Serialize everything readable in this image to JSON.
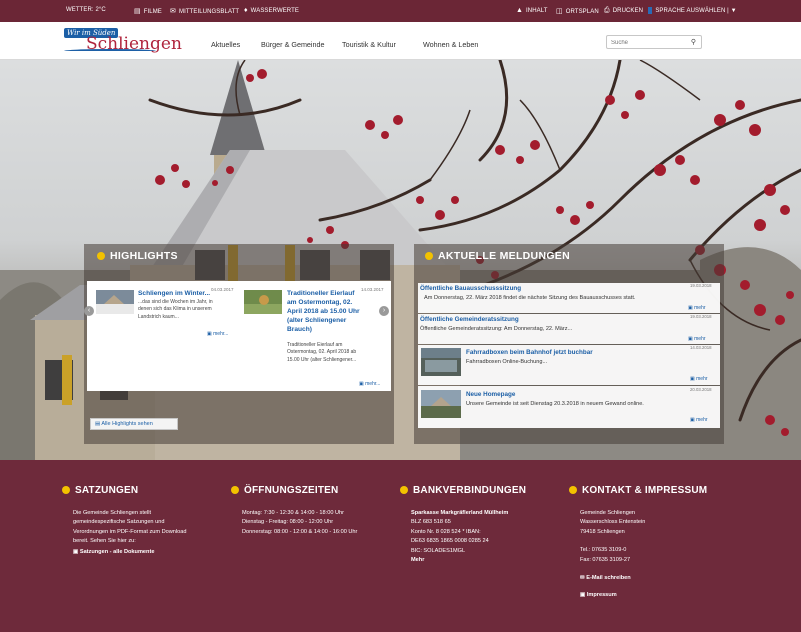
{
  "topbar": {
    "weather": "WETTER: 2°C",
    "film": "FILME",
    "newsletter": "MITTEILUNGSBLATT",
    "water": "WASSERWERTE",
    "contents": "INHALT",
    "city_map": "ORTSPLAN",
    "print": "DRUCKEN",
    "language": "SPRACHE AUSWÄHLEN | ▼"
  },
  "logo": {
    "tagline": "Wir im Süden",
    "name": "Schliengen"
  },
  "nav": {
    "items": [
      "Aktuelles",
      "Bürger & Gemeinde",
      "Touristik & Kultur",
      "Wohnen & Leben"
    ]
  },
  "search": {
    "placeholder": "Suche"
  },
  "highlights": {
    "title": "HIGHLIGHTS",
    "all_label": "Alle Highlights sehen",
    "cards": [
      {
        "title": "Schliengen im Winter...",
        "date": "04.03.2017",
        "lines": [
          "...das sind die Wochen im Jahr, in",
          "denen sich das Klima in unserem",
          "Landstrich kaum..."
        ],
        "more": "mehr..."
      },
      {
        "title_lines": [
          "Traditioneller Eierlauf",
          "am Ostermontag, 02.",
          "April 2018 ab 15.00 Uhr",
          "(alter Schliengener",
          "Brauch)"
        ],
        "date": "14.03.2017",
        "lines": [
          "Traditioneller Eierlauf am",
          "Ostermontag, 02. April 2018 ab",
          "15.00 Uhr (alter Schliengener..."
        ],
        "more": "mehr..."
      }
    ]
  },
  "news": {
    "title": "AKTUELLE MELDUNGEN",
    "more": "mehr",
    "items": [
      {
        "title": "Öffentliche Bauausschusssitzung",
        "text": "Am Donnerstag, 22. März 2018 findet die nächste Sitzung des Bauausschusses statt.",
        "date": "19.03.2018"
      },
      {
        "title": "Öffentliche Gemeinderatssitzung",
        "text": "Öffentliche Gemeinderatssitzung: Am Donnerstag, 22. März...",
        "date": "19.03.2018"
      },
      {
        "title": "Fahrradboxen beim Bahnhof jetzt buchbar",
        "text": "Fahrradboxen Online-Buchung...",
        "date": "14.03.2018"
      },
      {
        "title": "Neue Homepage",
        "text": "Unsere Gemeinde ist seit Dienstag 20.3.2018 in neuem Gewand online.",
        "date": "20.03.2018"
      }
    ]
  },
  "footer": {
    "satzungen": {
      "title": "SATZUNGEN",
      "lines": [
        "Die Gemeinde Schliengen stellt",
        "gemeindespezifische Satzungen und",
        "Verordnungen im PDF-Format zum Download",
        "bereit. Sehen Sie hier zu:"
      ],
      "link": "Satzungen - alle Dokumente"
    },
    "hours": {
      "title": "ÖFFNUNGSZEITEN",
      "lines": [
        "Montag: 7:30 - 12:30 & 14:00 - 18:00 Uhr",
        "Dienstag - Freitag: 08:00 - 12:00 Uhr",
        "Donnerstag: 08:00 - 12:00 & 14:00 - 16:00 Uhr"
      ]
    },
    "bank": {
      "title": "BANKVERBINDUNGEN",
      "bank_name": "Sparkasse Markgräflerland Müllheim",
      "lines": [
        "BLZ 683 518 65",
        "Konto Nr. 8 028 524 * IBAN:",
        "DE63 6835 1865 0008 0285 24",
        "BIC: SOLADES1MGL"
      ],
      "more": "Mehr"
    },
    "contact": {
      "title": "KONTAKT & IMPRESSUM",
      "address": [
        "Gemeinde Schliengen",
        "Wasserschloss Entenstein",
        "79418 Schliengen"
      ],
      "phone": "Tel.: 07635 3109-0",
      "fax": "Fax: 07635 3109-27",
      "email": "E-Mail schreiben",
      "imprint": "Impressum"
    }
  },
  "colors": {
    "topbar": "#6b2636",
    "footer": "#6e2a3b",
    "accent_yellow": "#f3c200",
    "link_blue": "#1c5fa6",
    "brand_red": "#b0243d"
  }
}
